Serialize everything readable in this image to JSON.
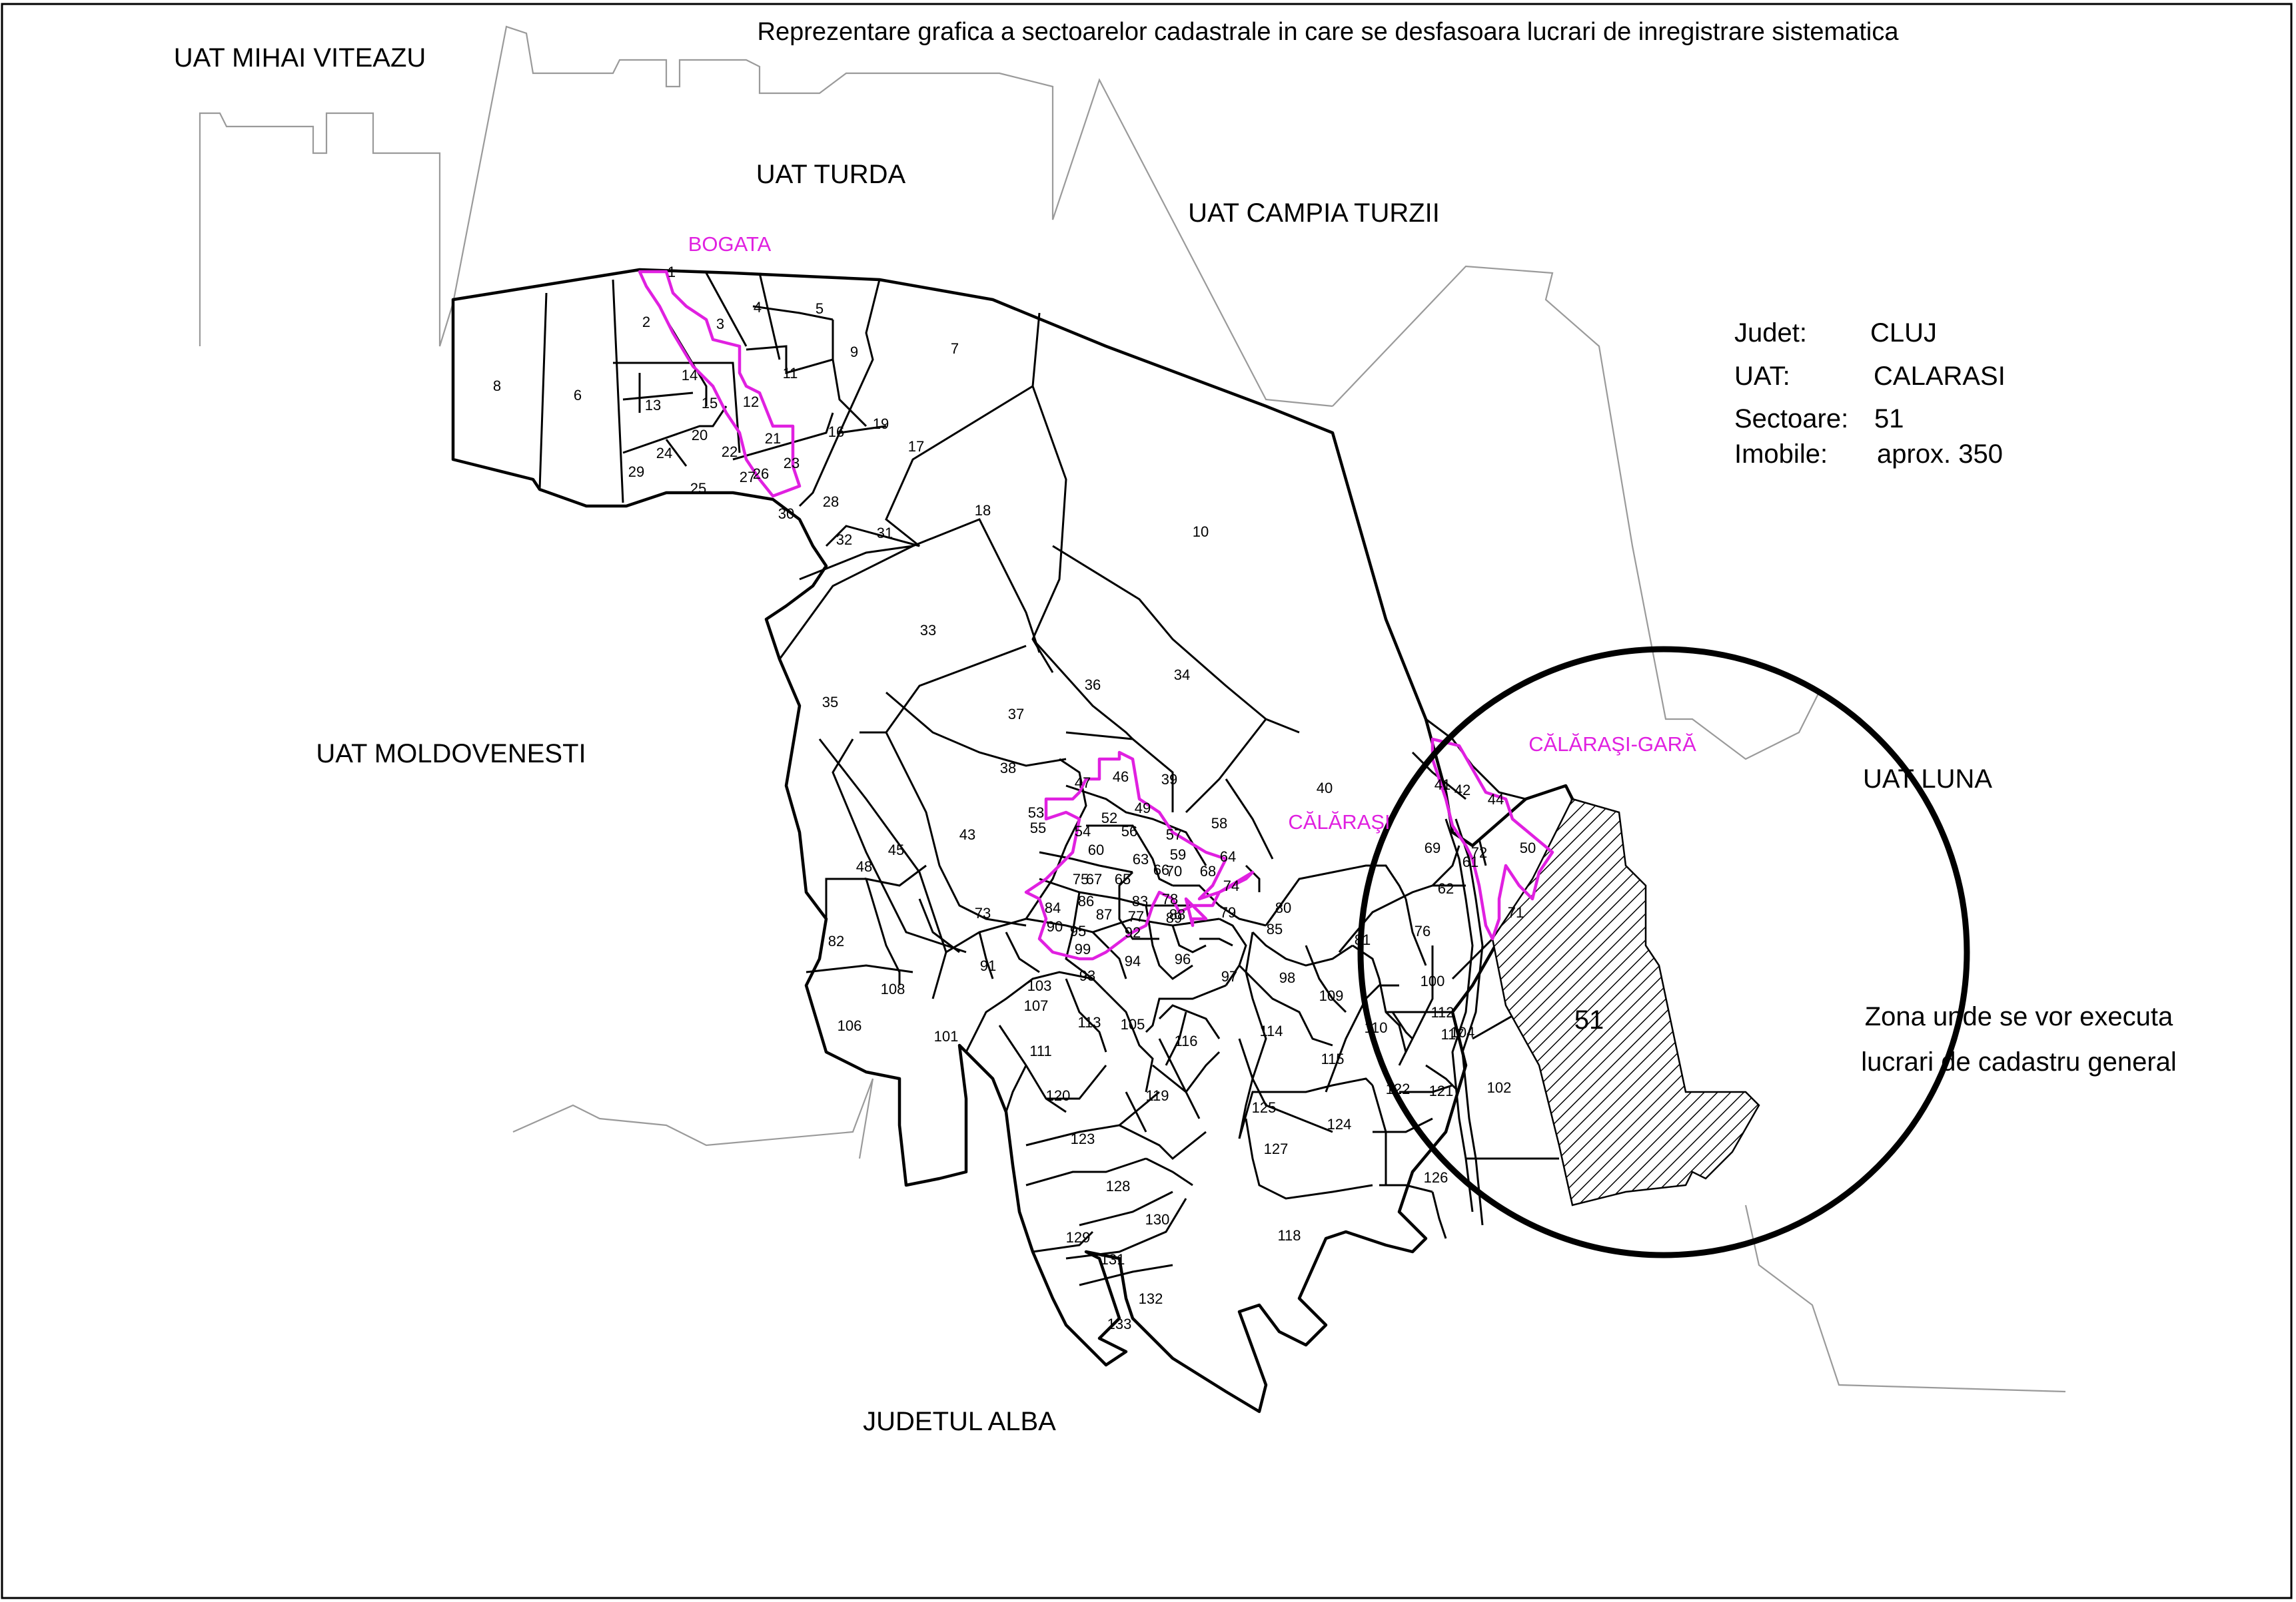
{
  "title": "Reprezentare grafica a sectoarelor cadastrale in care se desfasoara lucrari de inregistrare sistematica",
  "uat_labels": {
    "mihai_viteazu": "UAT MIHAI VITEAZU",
    "turda": "UAT TURDA",
    "campia_turzii": "UAT CAMPIA TURZII",
    "moldovenesti": "UAT MOLDOVENESTI",
    "luna": "UAT LUNA",
    "judetul_alba": "JUDETUL ALBA"
  },
  "localities": {
    "bogata": "BOGATA",
    "calarasi": "CĂLĂRAŞI",
    "calarasi_gara": "CĂLĂRAŞI-GARĂ"
  },
  "info": {
    "judet_label": "Judet:",
    "judet_value": "CLUJ",
    "uat_label": "UAT:",
    "uat_value": "CALARASI",
    "sectoare_label": "Sectoare:",
    "sectoare_value": "51",
    "imobile_label": "Imobile:",
    "imobile_value": "aprox. 350"
  },
  "zone": {
    "line1": "Zona unde se vor executa",
    "line2": "lucrari de cadastru general",
    "sector": "51"
  },
  "colors": {
    "intravilan": "#e020e0",
    "sector_lines": "#000000",
    "uat_border": "#9a9a9a"
  },
  "sector_numbers": [
    "1",
    "2",
    "3",
    "4",
    "5",
    "6",
    "7",
    "8",
    "9",
    "10",
    "11",
    "12",
    "13",
    "14",
    "15",
    "16",
    "17",
    "18",
    "19",
    "20",
    "21",
    "22",
    "23",
    "24",
    "25",
    "26",
    "27",
    "28",
    "29",
    "30",
    "31",
    "32",
    "33",
    "34",
    "35",
    "36",
    "37",
    "38",
    "39",
    "40",
    "41",
    "42",
    "43",
    "44",
    "45",
    "46",
    "47",
    "48",
    "49",
    "50",
    "51",
    "52",
    "53",
    "54",
    "55",
    "56",
    "57",
    "58",
    "59",
    "60",
    "61",
    "62",
    "63",
    "64",
    "65",
    "66",
    "67",
    "68",
    "69",
    "70",
    "71",
    "72",
    "73",
    "74",
    "75",
    "76",
    "77",
    "78",
    "79",
    "80",
    "81",
    "82",
    "83",
    "84",
    "85",
    "86",
    "87",
    "88",
    "89",
    "90",
    "91",
    "92",
    "93",
    "94",
    "95",
    "96",
    "97",
    "98",
    "99",
    "100",
    "101",
    "102",
    "103",
    "104",
    "105",
    "106",
    "107",
    "108",
    "109",
    "110",
    "111",
    "112",
    "113",
    "114",
    "115",
    "116",
    "117",
    "118",
    "119",
    "120",
    "121",
    "122",
    "123",
    "124",
    "125",
    "126",
    "127",
    "128",
    "129",
    "130",
    "131",
    "132",
    "133"
  ]
}
